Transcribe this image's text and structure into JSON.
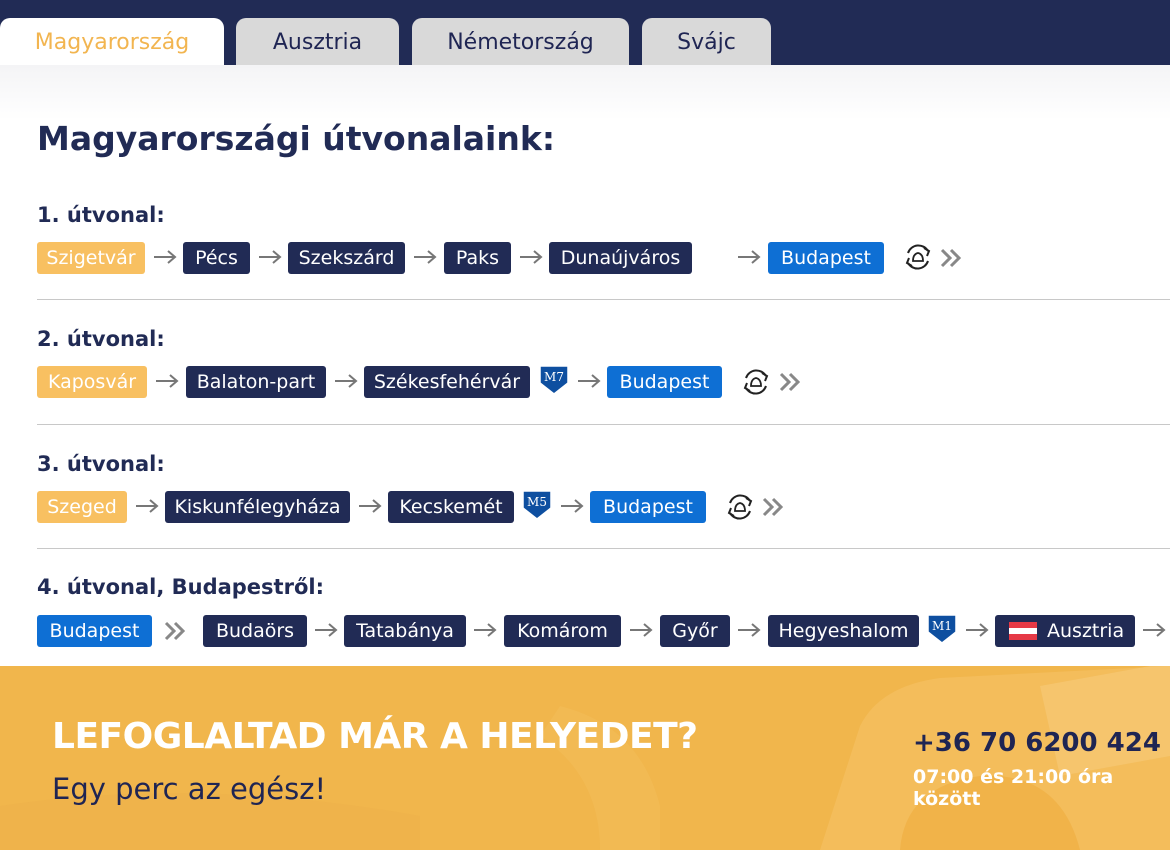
{
  "tabs": [
    {
      "label": "Magyarország",
      "active": true
    },
    {
      "label": "Ausztria",
      "active": false
    },
    {
      "label": "Németország",
      "active": false
    },
    {
      "label": "Svájc",
      "active": false
    }
  ],
  "heading": "Magyarországi útvonalaink:",
  "routes": [
    {
      "title": "1. útvonal:",
      "stops": [
        {
          "label": "Szigetvár",
          "kind": "start"
        },
        {
          "label": "Pécs",
          "kind": "mid"
        },
        {
          "label": "Szekszárd",
          "kind": "mid"
        },
        {
          "label": "Paks",
          "kind": "mid"
        },
        {
          "label": "Dunaújváros",
          "kind": "mid"
        },
        {
          "label": "Budapest",
          "kind": "end"
        }
      ],
      "icons": [
        "arrow-right-icon",
        "round-trip-icon",
        "double-chevron-right-icon"
      ]
    },
    {
      "title": "2. útvonal:",
      "stops": [
        {
          "label": "Kaposvár",
          "kind": "start"
        },
        {
          "label": "Balaton-part",
          "kind": "mid"
        },
        {
          "label": "Székesfehérvár",
          "kind": "mid"
        },
        {
          "label": "Budapest",
          "kind": "end"
        }
      ],
      "motorway": "M7"
    },
    {
      "title": "3. útvonal:",
      "stops": [
        {
          "label": "Szeged",
          "kind": "start"
        },
        {
          "label": "Kiskunfélegyháza",
          "kind": "mid"
        },
        {
          "label": "Kecskemét",
          "kind": "mid"
        },
        {
          "label": "Budapest",
          "kind": "end"
        }
      ],
      "motorway": "M5"
    },
    {
      "title": "4. útvonal, Budapestről:",
      "stops": [
        {
          "label": "Budapest",
          "kind": "end"
        },
        {
          "label": "Budaörs",
          "kind": "mid"
        },
        {
          "label": "Tatabánya",
          "kind": "mid"
        },
        {
          "label": "Komárom",
          "kind": "mid"
        },
        {
          "label": "Győr",
          "kind": "mid"
        },
        {
          "label": "Hegyeshalom",
          "kind": "mid"
        },
        {
          "label": "Ausztria",
          "kind": "mid",
          "flag": "austria-flag-icon"
        }
      ],
      "motorway": "M1"
    }
  ],
  "cta": {
    "title": "LEFOGLALTAD MÁR A HELYEDET?",
    "subtitle": "Egy perc az egész!",
    "phone": "+36 70 6200 424",
    "hours": "07:00 és 21:00 óra között"
  },
  "colors": {
    "navy": "#212b55",
    "start_chip": "#f8c061",
    "end_chip": "#0e6fd4",
    "banner": "#f1b64c",
    "active_tab_text": "#f2b550"
  }
}
